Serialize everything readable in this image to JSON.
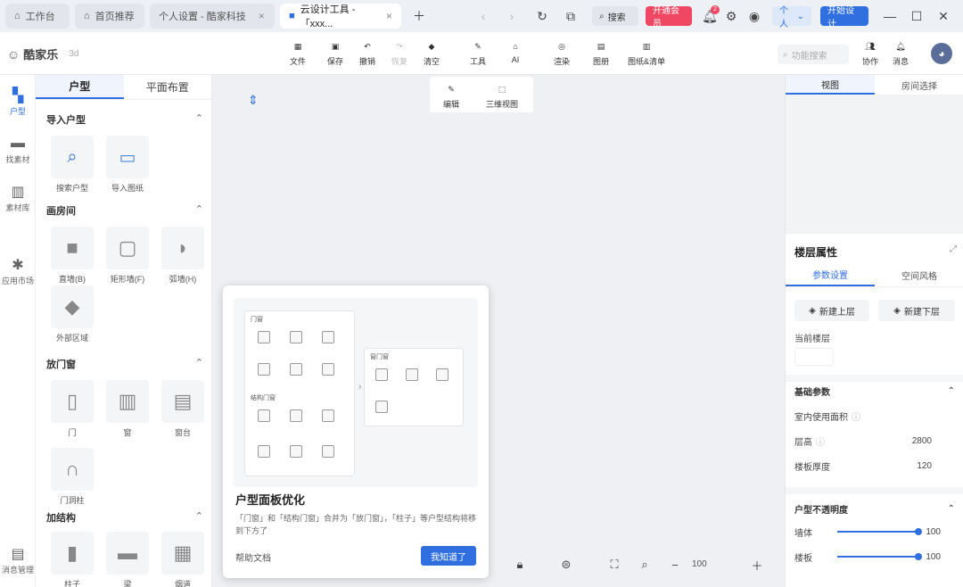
{
  "titlebar": {
    "tabs": [
      {
        "label": "工作台"
      },
      {
        "label": "首页推荐"
      },
      {
        "label": "个人设置 - 酷家科技"
      },
      {
        "label": "云设计工具 -「xxx..."
      }
    ],
    "search_label": "搜索",
    "promo_label": "开通会员",
    "notification_count": "2",
    "account_label": "个人",
    "start_button": "开始设计"
  },
  "brand": {
    "name": "酷家乐",
    "sub": "3d"
  },
  "toolbar": {
    "tools": [
      "文件",
      "保存",
      "撤销",
      "恢复",
      "清空",
      "工具",
      "AI",
      "渲染",
      "图册",
      "图纸&清单"
    ],
    "right_search_placeholder": "功能搜索",
    "collab_label": "协作",
    "message_label": "消息"
  },
  "floating_tools": [
    "编辑",
    "三维视图"
  ],
  "rail": [
    "户型",
    "找素材",
    "素材库",
    "应用市场",
    "消息管理"
  ],
  "left_panel": {
    "tabs": [
      "户型",
      "平面布置"
    ],
    "sections": {
      "import": {
        "title": "导入户型",
        "items": [
          "搜索户型",
          "导入图纸"
        ]
      },
      "walls": {
        "title": "画房间",
        "items": [
          "直墙(B)",
          "矩形墙(F)",
          "弧墙(H)",
          "外部区域"
        ]
      },
      "doors": {
        "title": "放门窗",
        "items": [
          "门",
          "窗",
          "窗台",
          "门洞柱"
        ]
      },
      "structure": {
        "title": "加结构",
        "items": [
          "柱子",
          "梁",
          "烟道"
        ]
      }
    }
  },
  "popup": {
    "title": "户型面板优化",
    "desc": "「门窗」和「结构门窗」合并为「放门窗」，「柱子」等户型结构将移到下方了",
    "help_link": "帮助文档",
    "confirm_button": "我知道了",
    "mini_panel_a": "门窗",
    "mini_panel_b": "结构门窗",
    "mini_panel_c": "窗门窗"
  },
  "right_panel": {
    "tabs": [
      "视图",
      "房间选择"
    ],
    "section_title": "楼层属性",
    "subtabs": [
      "参数设置",
      "空间风格"
    ],
    "add_above": "新建上层",
    "add_below": "新建下层",
    "current_floor_label": "当前楼层",
    "basic_params": "基础参数",
    "rows": [
      {
        "label": "室内使用面积",
        "value": ""
      },
      {
        "label": "层高",
        "value": "2800"
      },
      {
        "label": "楼板厚度",
        "value": "120"
      }
    ],
    "opacity_title": "户型不透明度",
    "sliders": [
      {
        "label": "墙体",
        "value": "100"
      },
      {
        "label": "楼板",
        "value": "100"
      }
    ]
  },
  "bottom": {
    "zoom": "100"
  },
  "colors": {
    "accent": "#2f6fe0",
    "promo": "#f04864"
  }
}
